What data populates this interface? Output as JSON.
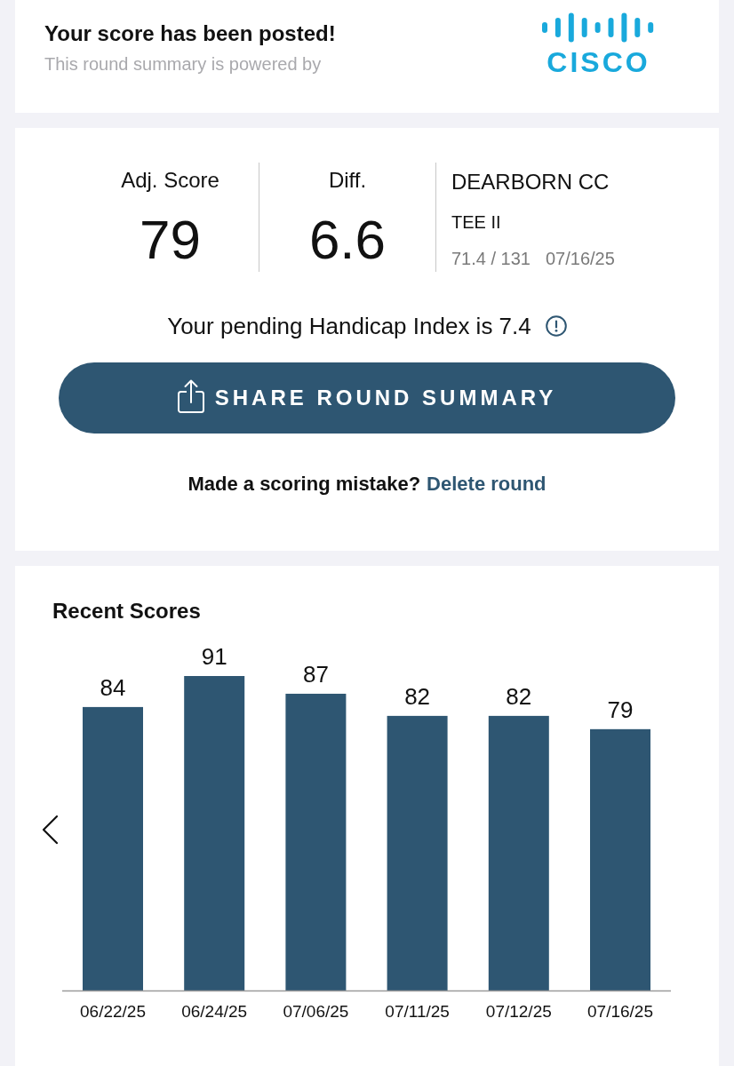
{
  "header": {
    "title": "Your score has been posted!",
    "subtitle": "This round summary is powered by",
    "logo_text": "CISCO"
  },
  "round": {
    "stats": [
      {
        "label": "Adj. Score",
        "value": "79"
      },
      {
        "label": "Diff.",
        "value": "6.6"
      }
    ],
    "course": {
      "name": "DEARBORN CC",
      "tee": "TEE II",
      "rating": "71.4 / 131",
      "date": "07/16/25"
    },
    "handicap_text": "Your pending Handicap Index is 7.4",
    "share_button": "SHARE ROUND SUMMARY",
    "mistake_prompt": "Made a scoring mistake?",
    "delete_link": "Delete round"
  },
  "recent_scores": {
    "title": "Recent Scores",
    "chart_data": {
      "type": "bar",
      "categories": [
        "06/22/25",
        "06/24/25",
        "07/06/25",
        "07/11/25",
        "07/12/25",
        "07/16/25"
      ],
      "values": [
        84,
        91,
        87,
        82,
        82,
        79
      ],
      "ylim": [
        20,
        91
      ],
      "data_labels": true
    }
  }
}
